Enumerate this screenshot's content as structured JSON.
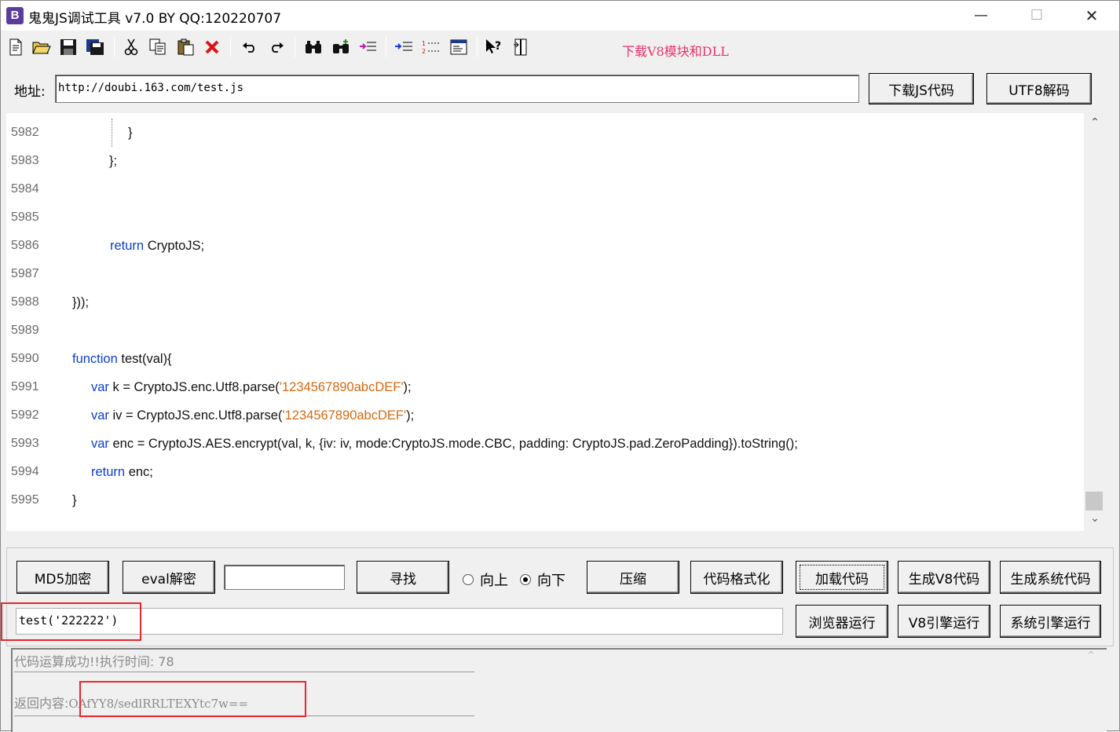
{
  "window": {
    "title": "鬼鬼JS调试工具 v7.0 BY QQ:120220707",
    "icon_letter": "B",
    "min": "—",
    "max": "☐",
    "close": "✕"
  },
  "toolbar": {
    "icons": [
      "new-file-icon",
      "open-folder-icon",
      "save-icon",
      "save-all-icon",
      "cut-icon",
      "copy-icon",
      "paste-icon",
      "delete-icon",
      "undo-icon",
      "redo-icon",
      "find-icon",
      "find-next-icon",
      "replace-icon",
      "indent-icon",
      "numbered-list-icon",
      "window-icon",
      "help-pointer-icon",
      "column-icon"
    ],
    "download_link": "下载V8模块和DLL"
  },
  "address": {
    "label": "地址:",
    "value": "http://doubi.163.com/test.js",
    "download_js_button": "下载JS代码",
    "utf8_decode_button": "UTF8解码"
  },
  "editor": {
    "lines": [
      {
        "num": "5982",
        "segs": [
          {
            "t": "}",
            "c": ""
          }
        ],
        "indent": 162,
        "guide": true
      },
      {
        "num": "5983",
        "segs": [
          {
            "t": "};",
            "c": ""
          }
        ],
        "indent": 138
      },
      {
        "num": "5984",
        "segs": [],
        "indent": 90
      },
      {
        "num": "5985",
        "segs": [],
        "indent": 90
      },
      {
        "num": "5986",
        "segs": [
          {
            "t": "return",
            "c": "kw"
          },
          {
            "t": " CryptoJS;",
            "c": ""
          }
        ],
        "indent": 139
      },
      {
        "num": "5987",
        "segs": [],
        "indent": 90
      },
      {
        "num": "5988",
        "segs": [
          {
            "t": "}));",
            "c": ""
          }
        ],
        "indent": 91
      },
      {
        "num": "5989",
        "segs": [],
        "indent": 90
      },
      {
        "num": "5990",
        "segs": [
          {
            "t": "function",
            "c": "kw"
          },
          {
            "t": " test(val){",
            "c": ""
          }
        ],
        "indent": 91
      },
      {
        "num": "5991",
        "segs": [
          {
            "t": "var",
            "c": "kw"
          },
          {
            "t": " k = CryptoJS.enc.Utf8.parse(",
            "c": ""
          },
          {
            "t": "'1234567890abcDEF'",
            "c": "str"
          },
          {
            "t": ");",
            "c": ""
          }
        ],
        "indent": 115
      },
      {
        "num": "5992",
        "segs": [
          {
            "t": "var",
            "c": "kw"
          },
          {
            "t": " iv = CryptoJS.enc.Utf8.parse(",
            "c": ""
          },
          {
            "t": "'1234567890abcDEF'",
            "c": "str"
          },
          {
            "t": ");",
            "c": ""
          }
        ],
        "indent": 115
      },
      {
        "num": "5993",
        "segs": [
          {
            "t": "var",
            "c": "kw"
          },
          {
            "t": " enc = CryptoJS.AES.encrypt(val, k, {iv: iv, mode:CryptoJS.mode.CBC, padding: CryptoJS.pad.ZeroPadding}).toString();",
            "c": ""
          }
        ],
        "indent": 115
      },
      {
        "num": "5994",
        "segs": [
          {
            "t": "return",
            "c": "kw"
          },
          {
            "t": " enc;",
            "c": ""
          }
        ],
        "indent": 115
      },
      {
        "num": "5995",
        "segs": [
          {
            "t": "}",
            "c": ""
          }
        ],
        "indent": 91
      }
    ],
    "scroll_up": "⌃",
    "scroll_down": "⌄"
  },
  "controls": {
    "md5_button": "MD5加密",
    "eval_button": "eval解密",
    "find_button": "寻找",
    "radio_up": "向上",
    "radio_down": "向下",
    "compress_button": "压缩",
    "format_button": "代码格式化",
    "load_button": "加载代码",
    "gen_v8_button": "生成V8代码",
    "gen_sys_button": "生成系统代码",
    "command_value": "test('222222')",
    "browser_run_button": "浏览器运行",
    "v8_run_button": "V8引擎运行",
    "sys_run_button": "系统引擎运行"
  },
  "result": {
    "status_line": "代码运算成功!!执行时间: 78",
    "return_label": "返回内容:",
    "return_value": "OAfYY8/sedlRRLTEXYtc7w=="
  },
  "colors": {
    "keyword": "#0b3fcf",
    "string": "#d66a10",
    "download_link": "#e8326a",
    "highlight_box": "#e8262b"
  }
}
